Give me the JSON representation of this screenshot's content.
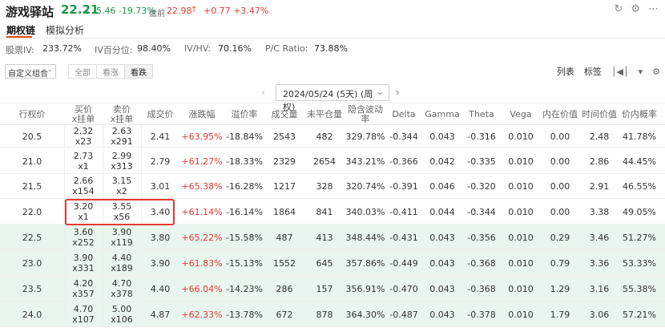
{
  "header": {
    "name": "游戏驿站",
    "price": "22.21",
    "arrow": "↓",
    "change": "-5.46 -19.73%",
    "premarket_label": "盘前",
    "premarket_price": "22.98",
    "premarket_arrow": "↑",
    "premarket_change": "+0.77 +3.47%"
  },
  "tabs": [
    {
      "label": "期权链",
      "active": true
    },
    {
      "label": "模拟分析",
      "active": false
    }
  ],
  "metrics": {
    "iv_label": "股票IV:",
    "iv_value": "233.72%",
    "ivp_label": "IV百分位:",
    "ivp_value": "98.40%",
    "ivhv_label": "IV/HV:",
    "ivhv_value": "70.16%",
    "pcr_label": "P/C Ratio:",
    "pcr_value": "73.88%"
  },
  "filters": {
    "combo_label": "自定义组合",
    "segments": [
      "全部",
      "看涨",
      "看跌"
    ],
    "selected_segment": "看跌",
    "list_label": "列表",
    "tag_label": "标签"
  },
  "date_selector": {
    "value": "2024/05/24 (5天) (周权)"
  },
  "table": {
    "headers": {
      "strike": "行权价",
      "bid_top": "买价",
      "bid_bottom": "x挂单",
      "ask_top": "卖价",
      "ask_bottom": "x挂单",
      "last": "成交价",
      "change_pct": "涨跌幅",
      "premium": "溢价率",
      "volume": "成交量",
      "open_interest": "未平仓量",
      "iv": "隐含波动率",
      "delta": "Delta",
      "gamma": "Gamma",
      "theta": "Theta",
      "vega": "Vega",
      "intrinsic": "内在价值",
      "time_value": "时间价值",
      "itm_prob": "价内概率"
    },
    "rows": [
      {
        "strike": "20.5",
        "bid": "2.32",
        "bid_size": "x23",
        "ask": "2.63",
        "ask_size": "x291",
        "last": "2.41",
        "change_pct": "+63.95%",
        "premium": "-18.84%",
        "volume": "2543",
        "oi": "482",
        "iv": "329.78%",
        "delta": "-0.344",
        "gamma": "0.043",
        "theta": "-0.316",
        "vega": "0.010",
        "intrinsic": "0.00",
        "time_value": "2.48",
        "itm_prob": "41.78%",
        "itm": false
      },
      {
        "strike": "21.0",
        "bid": "2.73",
        "bid_size": "x1",
        "ask": "2.99",
        "ask_size": "x313",
        "last": "2.79",
        "change_pct": "+61.27%",
        "premium": "-18.33%",
        "volume": "2329",
        "oi": "2654",
        "iv": "343.21%",
        "delta": "-0.366",
        "gamma": "0.042",
        "theta": "-0.335",
        "vega": "0.010",
        "intrinsic": "0.00",
        "time_value": "2.86",
        "itm_prob": "44.45%",
        "itm": false
      },
      {
        "strike": "21.5",
        "bid": "2.66",
        "bid_size": "x154",
        "ask": "3.15",
        "ask_size": "x2",
        "last": "3.01",
        "change_pct": "+65.38%",
        "premium": "-16.28%",
        "volume": "1217",
        "oi": "328",
        "iv": "320.74%",
        "delta": "-0.391",
        "gamma": "0.046",
        "theta": "-0.320",
        "vega": "0.010",
        "intrinsic": "0.00",
        "time_value": "2.91",
        "itm_prob": "46.55%",
        "itm": false
      },
      {
        "strike": "22.0",
        "bid": "3.20",
        "bid_size": "x1",
        "ask": "3.55",
        "ask_size": "x56",
        "last": "3.40",
        "change_pct": "+61.14%",
        "premium": "-16.14%",
        "volume": "1864",
        "oi": "841",
        "iv": "340.03%",
        "delta": "-0.411",
        "gamma": "0.044",
        "theta": "-0.344",
        "vega": "0.010",
        "intrinsic": "0.00",
        "time_value": "3.38",
        "itm_prob": "49.05%",
        "itm": false
      },
      {
        "strike": "22.5",
        "bid": "3.60",
        "bid_size": "x252",
        "ask": "3.90",
        "ask_size": "x119",
        "last": "3.80",
        "change_pct": "+65.22%",
        "premium": "-15.58%",
        "volume": "487",
        "oi": "413",
        "iv": "348.44%",
        "delta": "-0.431",
        "gamma": "0.043",
        "theta": "-0.356",
        "vega": "0.010",
        "intrinsic": "0.29",
        "time_value": "3.46",
        "itm_prob": "51.27%",
        "itm": true
      },
      {
        "strike": "23.0",
        "bid": "3.90",
        "bid_size": "x331",
        "ask": "4.40",
        "ask_size": "x189",
        "last": "3.90",
        "change_pct": "+61.83%",
        "premium": "-15.13%",
        "volume": "1552",
        "oi": "645",
        "iv": "357.86%",
        "delta": "-0.449",
        "gamma": "0.043",
        "theta": "-0.368",
        "vega": "0.010",
        "intrinsic": "0.79",
        "time_value": "3.36",
        "itm_prob": "53.33%",
        "itm": true
      },
      {
        "strike": "23.5",
        "bid": "4.20",
        "bid_size": "x357",
        "ask": "4.70",
        "ask_size": "x378",
        "last": "4.40",
        "change_pct": "+66.04%",
        "premium": "-14.23%",
        "volume": "286",
        "oi": "157",
        "iv": "356.91%",
        "delta": "-0.470",
        "gamma": "0.043",
        "theta": "-0.368",
        "vega": "0.010",
        "intrinsic": "1.29",
        "time_value": "3.16",
        "itm_prob": "55.38%",
        "itm": true
      },
      {
        "strike": "24.0",
        "bid": "4.70",
        "bid_size": "x107",
        "ask": "5.00",
        "ask_size": "x106",
        "last": "4.87",
        "change_pct": "+62.33%",
        "premium": "-13.78%",
        "volume": "672",
        "oi": "878",
        "iv": "364.30%",
        "delta": "-0.487",
        "gamma": "0.043",
        "theta": "-0.378",
        "vega": "0.010",
        "intrinsic": "1.79",
        "time_value": "3.06",
        "itm_prob": "57.21%",
        "itm": true
      }
    ]
  }
}
